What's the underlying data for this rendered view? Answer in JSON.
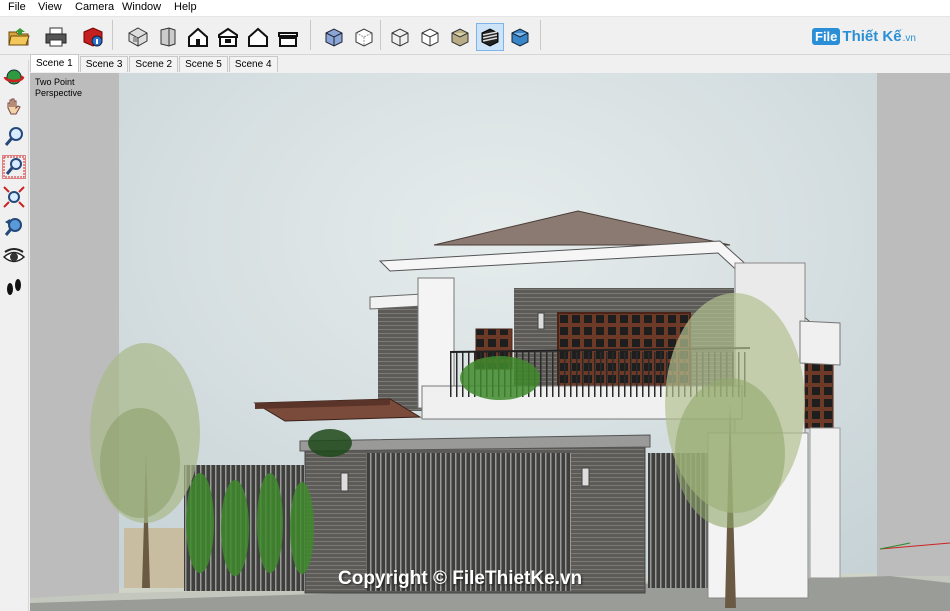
{
  "menu": [
    "File",
    "View",
    "Camera",
    "Window",
    "Help"
  ],
  "toolbar": {
    "group1": [
      "open-folder-icon",
      "print-icon",
      "model-info-icon"
    ],
    "group2": [
      "iso-view-icon",
      "top-view-icon",
      "front-view-icon",
      "right-view-icon",
      "back-view-icon",
      "left-view-icon"
    ],
    "group3": [
      "xray-icon",
      "back-edges-icon"
    ],
    "group4": [
      "wireframe-icon",
      "hidden-line-icon",
      "shaded-icon",
      "shaded-textures-icon",
      "monochrome-icon"
    ]
  },
  "brand": {
    "badge": "File",
    "name": "Thiết Kế",
    "tld": ".vn"
  },
  "scenes": [
    "Scene 1",
    "Scene 3",
    "Scene 2",
    "Scene 5",
    "Scene 4"
  ],
  "active_scene": "Scene 1",
  "left_tools": [
    "orbit-icon",
    "pan-icon",
    "zoom-icon",
    "zoom-window-icon",
    "zoom-extents-icon",
    "zoom-previous-icon",
    "look-around-icon",
    "walk-icon"
  ],
  "view_label": {
    "line1": "Two Point",
    "line2": "Perspective"
  },
  "copyright": "Copyright © FileThietKe.vn",
  "colors": {
    "sky": "#cfd6d8",
    "wall_dark": "#5a5a58",
    "wall_white": "#f2f2f2",
    "roof": "#8a7a72",
    "wood": "#6e3a28",
    "tree": "#8fa86a"
  }
}
